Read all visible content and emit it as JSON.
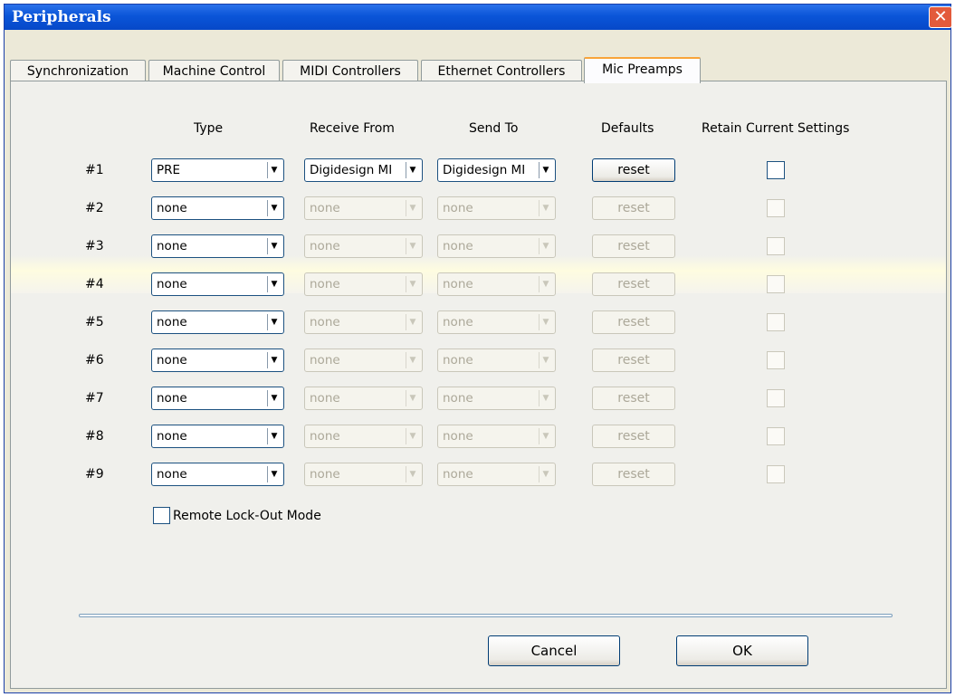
{
  "window": {
    "title": "Peripherals"
  },
  "tabs": [
    "Synchronization",
    "Machine Control",
    "MIDI Controllers",
    "Ethernet Controllers",
    "Mic Preamps"
  ],
  "active_tab": "Mic Preamps",
  "columns": {
    "type": "Type",
    "receive": "Receive From",
    "send": "Send To",
    "defaults": "Defaults",
    "retain": "Retain Current Settings"
  },
  "rows": [
    {
      "label": "#1",
      "type": "PRE",
      "receive": "Digidesign MI",
      "send": "Digidesign MI",
      "reset": "reset",
      "enabled": true
    },
    {
      "label": "#2",
      "type": "none",
      "receive": "none",
      "send": "none",
      "reset": "reset",
      "enabled": false
    },
    {
      "label": "#3",
      "type": "none",
      "receive": "none",
      "send": "none",
      "reset": "reset",
      "enabled": false
    },
    {
      "label": "#4",
      "type": "none",
      "receive": "none",
      "send": "none",
      "reset": "reset",
      "enabled": false
    },
    {
      "label": "#5",
      "type": "none",
      "receive": "none",
      "send": "none",
      "reset": "reset",
      "enabled": false
    },
    {
      "label": "#6",
      "type": "none",
      "receive": "none",
      "send": "none",
      "reset": "reset",
      "enabled": false
    },
    {
      "label": "#7",
      "type": "none",
      "receive": "none",
      "send": "none",
      "reset": "reset",
      "enabled": false
    },
    {
      "label": "#8",
      "type": "none",
      "receive": "none",
      "send": "none",
      "reset": "reset",
      "enabled": false
    },
    {
      "label": "#9",
      "type": "none",
      "receive": "none",
      "send": "none",
      "reset": "reset",
      "enabled": false
    }
  ],
  "remote_lockout": {
    "label": "Remote Lock-Out Mode",
    "checked": false
  },
  "buttons": {
    "cancel": "Cancel",
    "ok": "OK"
  }
}
